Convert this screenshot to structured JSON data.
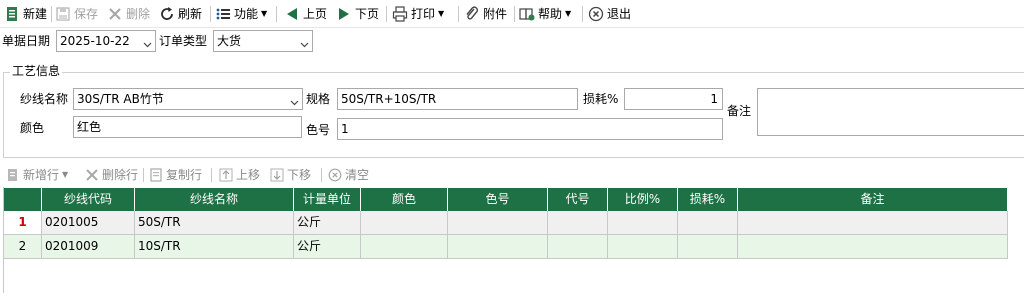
{
  "toolbar": {
    "new": "新建",
    "save": "保存",
    "delete": "删除",
    "refresh": "刷新",
    "function": "功能",
    "prev": "上页",
    "next": "下页",
    "print": "打印",
    "attach": "附件",
    "help": "帮助",
    "exit": "退出"
  },
  "header_form": {
    "date_label": "单据日期",
    "date_value": "2025-10-22",
    "order_type_label": "订单类型",
    "order_type_value": "大货"
  },
  "craft": {
    "group_title": "工艺信息",
    "yarn_name_label": "纱线名称",
    "yarn_name_value": "30S/TR AB竹节",
    "spec_label": "规格",
    "spec_value": "50S/TR+10S/TR",
    "loss_label": "损耗%",
    "loss_value": "1",
    "remark_label": "备注",
    "remark_value": "",
    "color_label": "颜色",
    "color_value": "红色",
    "color_no_label": "色号",
    "color_no_value": "1"
  },
  "grid_toolbar": {
    "add_row": "新增行",
    "delete_row": "删除行",
    "copy_row": "复制行",
    "move_up": "上移",
    "move_down": "下移",
    "clear": "清空"
  },
  "grid": {
    "columns": [
      "纱线代码",
      "纱线名称",
      "计量单位",
      "颜色",
      "色号",
      "代号",
      "比例%",
      "损耗%",
      "备注"
    ],
    "rows": [
      {
        "num": "1",
        "code": "0201005",
        "name": "50S/TR",
        "unit": "公斤",
        "color": "",
        "color_no": "",
        "alias": "",
        "ratio": "",
        "loss": "",
        "remark": ""
      },
      {
        "num": "2",
        "code": "0201009",
        "name": "10S/TR",
        "unit": "公斤",
        "color": "",
        "color_no": "",
        "alias": "",
        "ratio": "",
        "loss": "",
        "remark": ""
      }
    ]
  },
  "colors": {
    "header_green": "#1e7145",
    "row_selected": "#f0f0f0",
    "row_alt": "#e8f6e8",
    "row_number_active": "#d00000"
  }
}
